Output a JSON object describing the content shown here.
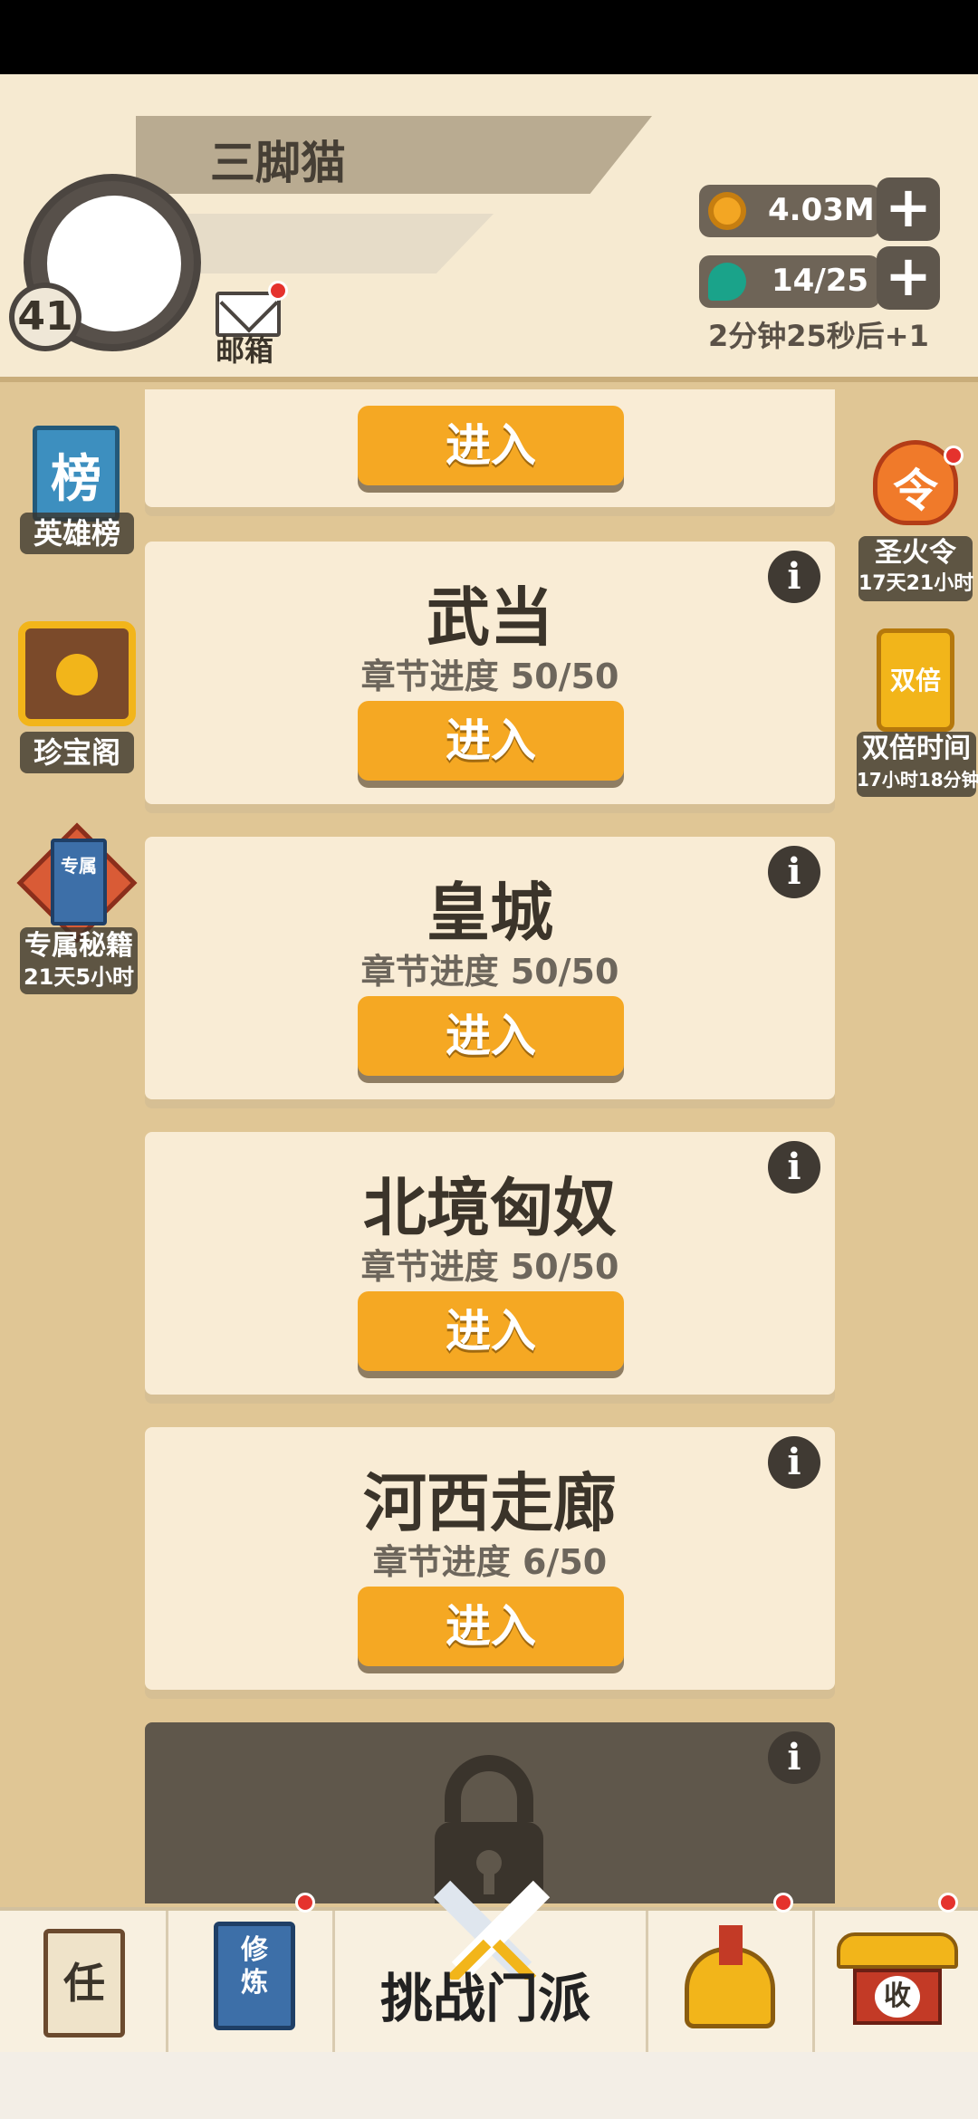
{
  "player": {
    "name": "三脚猫",
    "level": "41",
    "mail_label": "邮箱"
  },
  "resources": {
    "coins": "4.03M",
    "stamina": "14/25",
    "stamina_timer": "2分钟25秒后+1"
  },
  "left_menu": [
    {
      "label": "英雄榜",
      "icon": "ranking-banner-icon",
      "icon_text": "榜"
    },
    {
      "label": "珍宝阁",
      "icon": "treasure-chest-icon"
    },
    {
      "label": "专属秘籍",
      "sub": "21天5小时",
      "icon": "secret-book-icon",
      "icon_text": "专属"
    }
  ],
  "right_menu": [
    {
      "label": "圣火令",
      "sub": "17天21小时",
      "icon": "flame-token-icon",
      "icon_text": "令"
    },
    {
      "label": "双倍时间",
      "sub": "17小时18分钟",
      "icon": "double-card-icon",
      "icon_text": "双倍"
    }
  ],
  "cards": [
    {
      "title": "",
      "progress": "",
      "button": "进入"
    },
    {
      "title": "武当",
      "progress": "章节进度 50/50",
      "button": "进入"
    },
    {
      "title": "皇城",
      "progress": "章节进度 50/50",
      "button": "进入"
    },
    {
      "title": "北境匈奴",
      "progress": "章节进度 50/50",
      "button": "进入"
    },
    {
      "title": "河西走廊",
      "progress": "章节进度 6/50",
      "button": "进入"
    }
  ],
  "info_symbol": "i",
  "bottom_nav": {
    "task_icon_text": "任",
    "cultivate_icon_text": "修炼",
    "center_label": "挑战门派",
    "shop_icon_text": "收"
  },
  "colors": {
    "accent_button": "#f5a823",
    "background": "#e0c695",
    "card": "#f9ecd5",
    "notification": "#e5322d"
  }
}
